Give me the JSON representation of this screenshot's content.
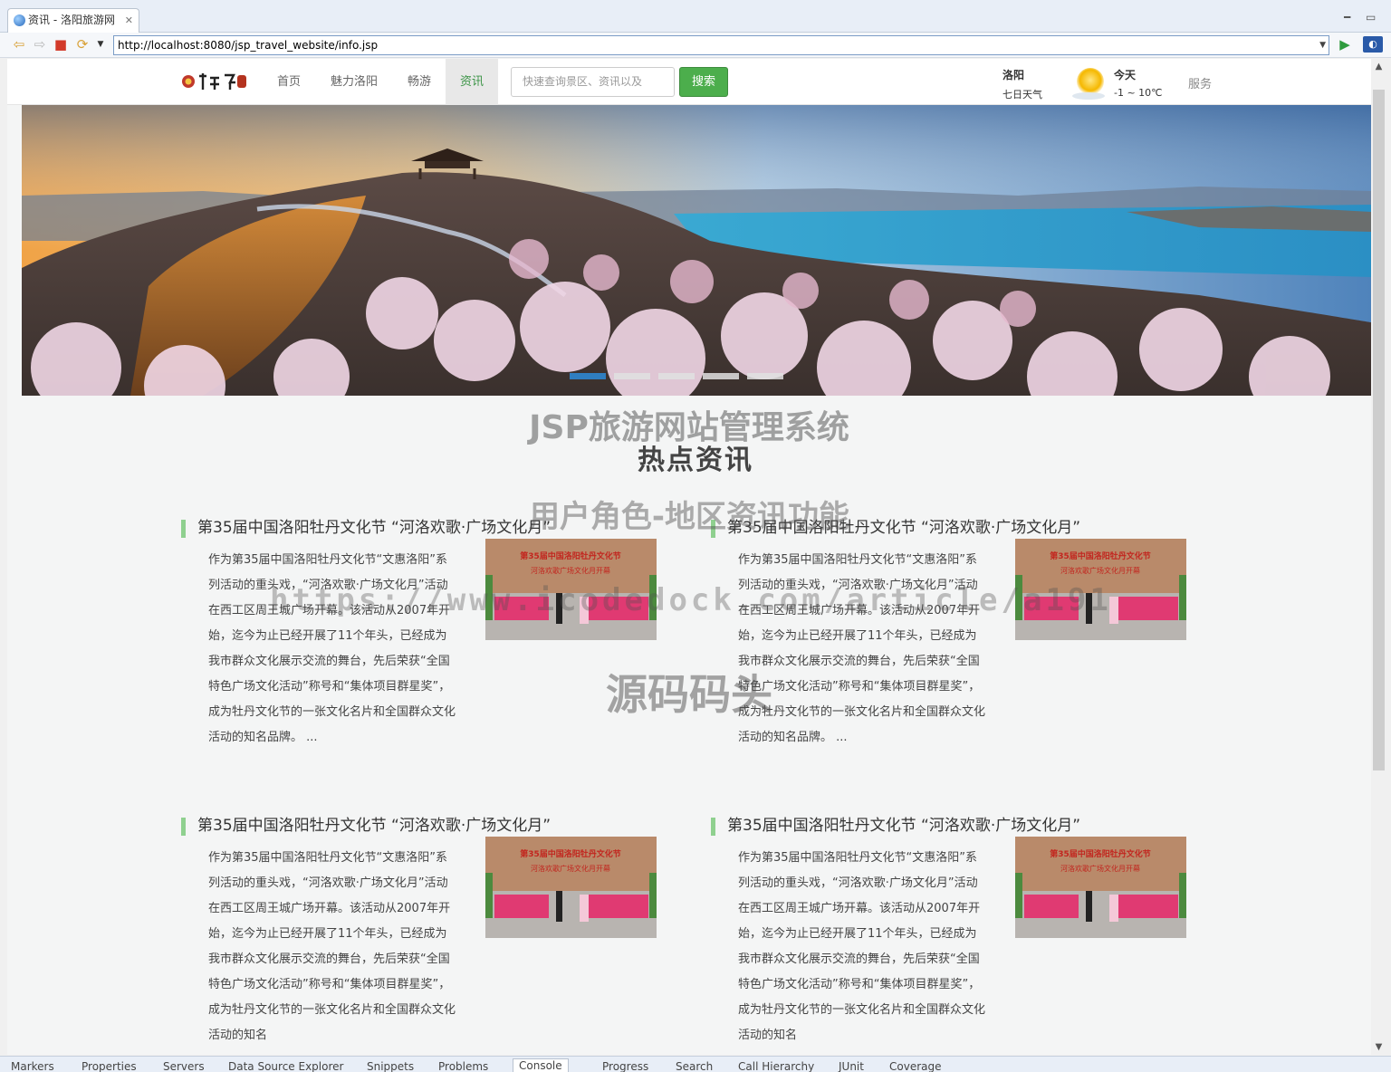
{
  "browser": {
    "tab_title": "资讯 - 洛阳旅游网",
    "tab_close": "✕",
    "url": "http://localhost:8080/jsp_travel_website/info.jsp"
  },
  "site": {
    "nav": [
      {
        "label": "首页",
        "active": false
      },
      {
        "label": "魅力洛阳",
        "active": false
      },
      {
        "label": "畅游",
        "active": false
      },
      {
        "label": "资讯",
        "active": true
      }
    ],
    "search_placeholder": "快速查询景区、资讯以及",
    "search_button": "搜索",
    "weather": {
      "city": "洛阳",
      "week_label": "七日天气",
      "day": "今天",
      "temp": "-1 ~ 10℃"
    },
    "service": "服务",
    "section_title": "热点资讯"
  },
  "watermarks": {
    "system_title": "JSP旅游网站管理系统",
    "function_title": "用户角色-地区资讯功能",
    "url": "https://www.icodedock.com/article/a191",
    "brand": "源码码头"
  },
  "news": [
    {
      "title": "第35届中国洛阳牡丹文化节 “河洛欢歌·广场文化月”",
      "body": "作为第35届中国洛阳牡丹文化节“文惠洛阳”系列活动的重头戏，“河洛欢歌·广场文化月”活动在西工区周王城广场开幕。该活动从2007年开始，迄今为止已经开展了11个年头，已经成为我市群众文化展示交流的舞台，先后荣获“全国特色广场文化活动”称号和“集体项目群星奖”，成为牡丹文化节的一张文化名片和全国群众文化活动的知名品牌。 ..."
    },
    {
      "title": "第35届中国洛阳牡丹文化节 “河洛欢歌·广场文化月”",
      "body": "作为第35届中国洛阳牡丹文化节“文惠洛阳”系列活动的重头戏，“河洛欢歌·广场文化月”活动在西工区周王城广场开幕。该活动从2007年开始，迄今为止已经开展了11个年头，已经成为我市群众文化展示交流的舞台，先后荣获“全国特色广场文化活动”称号和“集体项目群星奖”，成为牡丹文化节的一张文化名片和全国群众文化活动的知名品牌。 ..."
    },
    {
      "title": "第35届中国洛阳牡丹文化节 “河洛欢歌·广场文化月”",
      "body": "作为第35届中国洛阳牡丹文化节“文惠洛阳”系列活动的重头戏，“河洛欢歌·广场文化月”活动在西工区周王城广场开幕。该活动从2007年开始，迄今为止已经开展了11个年头，已经成为我市群众文化展示交流的舞台，先后荣获“全国特色广场文化活动”称号和“集体项目群星奖”，成为牡丹文化节的一张文化名片和全国群众文化活动的知名"
    },
    {
      "title": "第35届中国洛阳牡丹文化节 “河洛欢歌·广场文化月”",
      "body": "作为第35届中国洛阳牡丹文化节“文惠洛阳”系列活动的重头戏，“河洛欢歌·广场文化月”活动在西工区周王城广场开幕。该活动从2007年开始，迄今为止已经开展了11个年头，已经成为我市群众文化展示交流的舞台，先后荣获“全国特色广场文化活动”称号和“集体项目群星奖”，成为牡丹文化节的一张文化名片和全国群众文化活动的知名"
    }
  ],
  "ide_views": [
    "Markers",
    "Properties",
    "Servers",
    "Data Source Explorer",
    "Snippets",
    "Problems",
    "Console",
    "Progress",
    "Search",
    "Call Hierarchy",
    "JUnit",
    "Coverage"
  ],
  "colors": {
    "accent_green": "#4cae4c",
    "nav_active_text": "#3b9446",
    "carousel_active": "#2f7ec0"
  }
}
